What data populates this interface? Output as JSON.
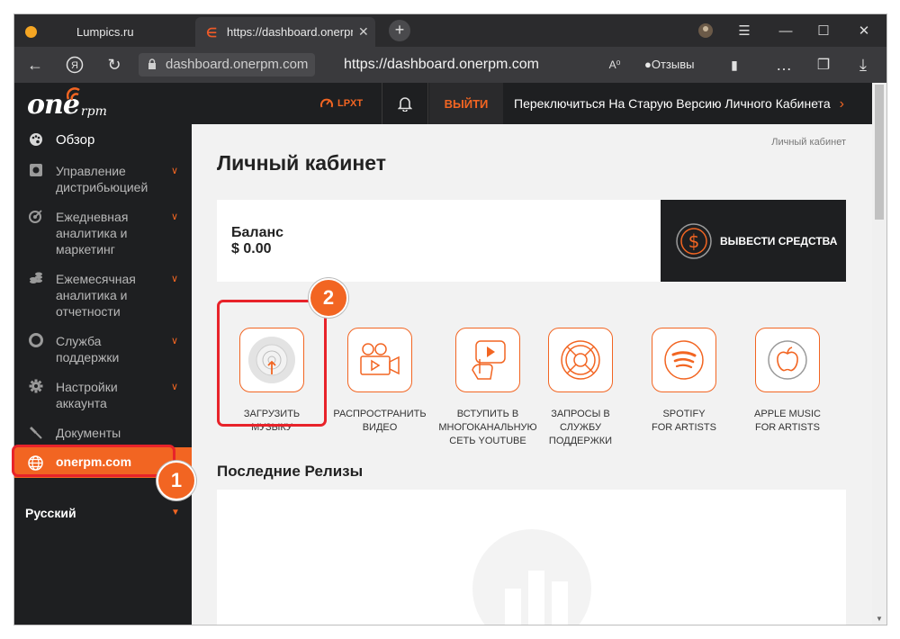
{
  "browser": {
    "tabs": [
      {
        "title": "Lumpics.ru"
      },
      {
        "title": "https://dashboard.onerpm.com"
      }
    ],
    "address_host": "dashboard.onerpm.com",
    "address_url": "https://dashboard.onerpm.com",
    "reviews_label": "Отзывы"
  },
  "header": {
    "brand": "one",
    "brand_suffix": "rpm",
    "lpxt": "LPXT",
    "logout": "ВЫЙТИ",
    "switch_label": "Переключиться На Старую Версию Личного Кабинета"
  },
  "sidebar": {
    "items": [
      {
        "label": "Обзор",
        "icon": "palette-icon"
      },
      {
        "label": "Управление\nдистрибьюцией",
        "icon": "distribution-icon"
      },
      {
        "label": "Ежедневная\nаналитика и\nмаркетинг",
        "icon": "target-icon"
      },
      {
        "label": "Ежемесячная\nаналитика и\nотчетности",
        "icon": "coins-icon"
      },
      {
        "label": "Служба\nподдержки",
        "icon": "lifebuoy-icon"
      },
      {
        "label": "Настройки\nаккаунта",
        "icon": "gear-icon"
      },
      {
        "label": "Документы",
        "icon": "stamp-icon"
      }
    ],
    "site_link": "onerpm.com",
    "language": "Русский"
  },
  "main": {
    "breadcrumb": "Личный кабинет",
    "title": "Личный кабинет",
    "balance_label": "Баланс",
    "balance_value": "$ 0.00",
    "withdraw_label": "ВЫВЕСТИ СРЕДСТВА",
    "actions": [
      {
        "label": "ЗАГРУЗИТЬ\nМУЗЫКУ",
        "icon": "upload-disc-icon"
      },
      {
        "label": "РАСПРОСТРАНИТЬ\nВИДЕО",
        "icon": "video-camera-icon"
      },
      {
        "label": "ВСТУПИТЬ В\nМНОГОКАНАЛЬНУЮ\nСЕТЬ YOUTUBE",
        "icon": "youtube-hand-icon"
      },
      {
        "label": "ЗАПРОСЫ В\nСЛУЖБУ\nПОДДЕРЖКИ",
        "icon": "lifebuoy-icon"
      },
      {
        "label": "SPOTIFY\nFOR ARTISTS",
        "icon": "spotify-icon"
      },
      {
        "label": "APPLE MUSIC\nFOR ARTISTS",
        "icon": "apple-icon"
      }
    ],
    "recent_releases": "Последние Релизы"
  },
  "annotations": {
    "badge1": "1",
    "badge2": "2",
    "highlight_color": "#e8232a",
    "accent": "#f26522"
  }
}
